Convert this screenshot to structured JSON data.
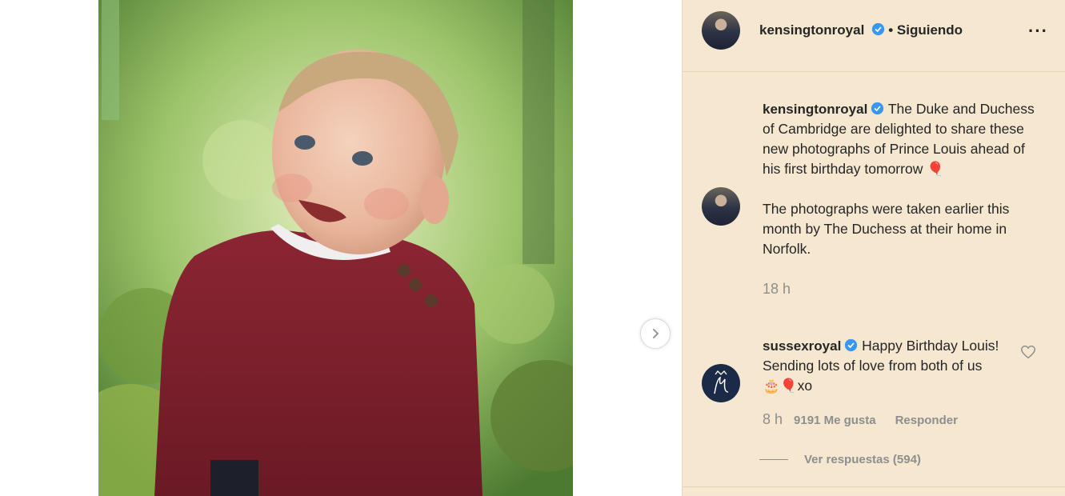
{
  "post": {
    "author": "kensingtonroyal",
    "follow_status": "• Siguiendo",
    "more_icon": "more-horizontal-icon",
    "verified_color": "#3897f0"
  },
  "caption": {
    "username": "kensingtonroyal",
    "paragraph1": "The Duke and Duchess of Cambridge are delighted to share these new photographs of Prince Louis ahead of his first birthday tomorrow",
    "paragraph1_emoji": "🎈",
    "paragraph2": "The photographs were taken earlier this month by The Duchess at their home in Norfolk.",
    "time": "18 h"
  },
  "comment": {
    "username": "sussexroyal",
    "text": "Happy Birthday Louis! Sending lots of love from both of us",
    "emojis": "🎂🎈",
    "suffix": "xo",
    "time": "8 h",
    "likes": "9191 Me gusta",
    "reply_label": "Responder",
    "view_replies": "Ver respuestas (594)"
  },
  "colors": {
    "panel_bg": "#f5e7d0",
    "muted_text": "#8e8e8e",
    "sweater": "#7e1f2b"
  }
}
